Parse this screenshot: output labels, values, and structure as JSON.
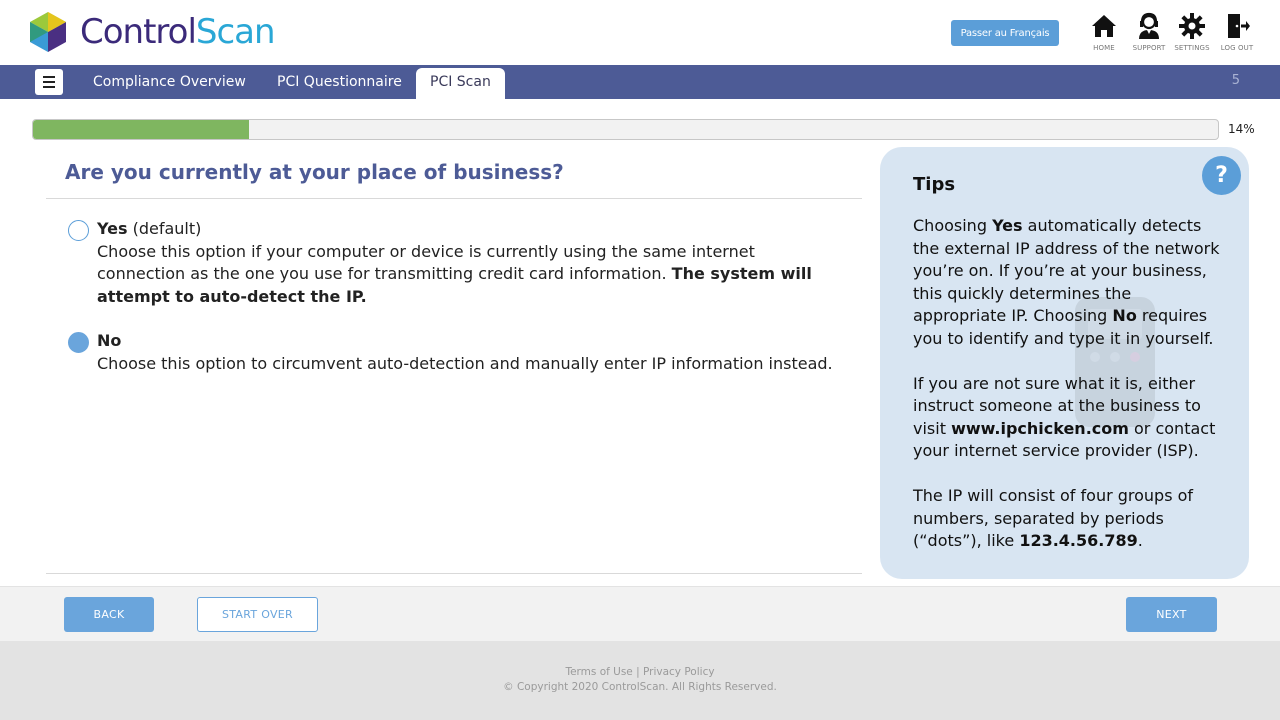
{
  "brand": {
    "part1": "Control",
    "part2": "Scan",
    "icon": "hexagon-cube-logo"
  },
  "header": {
    "language_button": "Passer au Français",
    "icons": [
      {
        "name": "home-icon",
        "label": "HOME"
      },
      {
        "name": "support-icon",
        "label": "SUPPORT"
      },
      {
        "name": "settings-icon",
        "label": "SETTINGS"
      },
      {
        "name": "logout-icon",
        "label": "LOG OUT"
      }
    ]
  },
  "nav": {
    "menu_icon": "hamburger-icon",
    "tabs": [
      {
        "label": "Compliance Overview",
        "active": false
      },
      {
        "label": "PCI Questionnaire",
        "active": false
      },
      {
        "label": "PCI Scan",
        "active": true
      }
    ],
    "count": "5"
  },
  "progress": {
    "percent_label": "14%",
    "value": 0.14
  },
  "question": {
    "title": "Are you currently at your place of business?",
    "options": [
      {
        "title": "Yes",
        "title_suffix": " (default)",
        "description": "Choose this option if your computer or device is currently using the same internet connection as the one you use for transmitting credit card information. ",
        "description_bold": "The system will attempt to auto-detect the IP.",
        "selected": false
      },
      {
        "title": "No",
        "title_suffix": "",
        "description": "Choose this option to circumvent auto-detection and manually enter IP information instead.",
        "description_bold": "",
        "selected": true
      }
    ]
  },
  "tips": {
    "title": "Tips",
    "help_symbol": "?",
    "p1": {
      "a": "Choosing ",
      "b1": "Yes",
      "c": " automatically detects the external IP address of the network you’re on. If you’re at your business, this quickly determines the appropriate IP. Choosing ",
      "b2": "No",
      "d": " requires you to identify and type it in yourself."
    },
    "p2": {
      "a": "If you are not sure what it is, either instruct someone at the business to visit ",
      "b": "www.ipchicken.com",
      "c": " or contact your internet service provider (ISP)."
    },
    "p3": {
      "a": "The IP will consist of four groups of numbers, separated by periods (“dots”), like ",
      "b": "123.4.56.789",
      "c": "."
    }
  },
  "buttons": {
    "back": "BACK",
    "start_over": "START OVER",
    "next": "NEXT"
  },
  "footer": {
    "terms": "Terms of Use",
    "separator": " | ",
    "privacy": "Privacy Policy",
    "copyright": "© Copyright 2020 ControlScan. All Rights Reserved."
  },
  "colors": {
    "nav": "#4d5b96",
    "accent": "#6aa5dc",
    "progress": "#7fb660",
    "tips_bg": "#d8e5f2"
  }
}
